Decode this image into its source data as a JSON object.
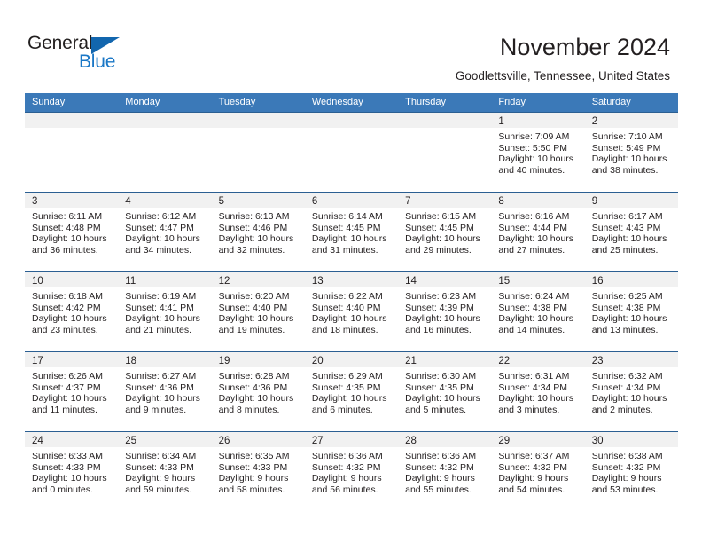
{
  "brand": {
    "word_one": "General",
    "word_two": "Blue",
    "triangle_color": "#1266ae",
    "blue_color": "#1a77c6"
  },
  "header": {
    "title": "November 2024",
    "location": "Goodlettsville, Tennessee, United States"
  },
  "theme": {
    "header_blue": "#3b79b8",
    "row_line": "#2b5f92",
    "daynum_band": "#f1f1f1",
    "text": "#231f20"
  },
  "weekdays": [
    "Sunday",
    "Monday",
    "Tuesday",
    "Wednesday",
    "Thursday",
    "Friday",
    "Saturday"
  ],
  "weeks": [
    [
      {
        "day": "",
        "sunrise": "",
        "sunset": "",
        "daylight_line1": "",
        "daylight_line2": ""
      },
      {
        "day": "",
        "sunrise": "",
        "sunset": "",
        "daylight_line1": "",
        "daylight_line2": ""
      },
      {
        "day": "",
        "sunrise": "",
        "sunset": "",
        "daylight_line1": "",
        "daylight_line2": ""
      },
      {
        "day": "",
        "sunrise": "",
        "sunset": "",
        "daylight_line1": "",
        "daylight_line2": ""
      },
      {
        "day": "",
        "sunrise": "",
        "sunset": "",
        "daylight_line1": "",
        "daylight_line2": ""
      },
      {
        "day": "1",
        "sunrise": "Sunrise: 7:09 AM",
        "sunset": "Sunset: 5:50 PM",
        "daylight_line1": "Daylight: 10 hours",
        "daylight_line2": "and 40 minutes."
      },
      {
        "day": "2",
        "sunrise": "Sunrise: 7:10 AM",
        "sunset": "Sunset: 5:49 PM",
        "daylight_line1": "Daylight: 10 hours",
        "daylight_line2": "and 38 minutes."
      }
    ],
    [
      {
        "day": "3",
        "sunrise": "Sunrise: 6:11 AM",
        "sunset": "Sunset: 4:48 PM",
        "daylight_line1": "Daylight: 10 hours",
        "daylight_line2": "and 36 minutes."
      },
      {
        "day": "4",
        "sunrise": "Sunrise: 6:12 AM",
        "sunset": "Sunset: 4:47 PM",
        "daylight_line1": "Daylight: 10 hours",
        "daylight_line2": "and 34 minutes."
      },
      {
        "day": "5",
        "sunrise": "Sunrise: 6:13 AM",
        "sunset": "Sunset: 4:46 PM",
        "daylight_line1": "Daylight: 10 hours",
        "daylight_line2": "and 32 minutes."
      },
      {
        "day": "6",
        "sunrise": "Sunrise: 6:14 AM",
        "sunset": "Sunset: 4:45 PM",
        "daylight_line1": "Daylight: 10 hours",
        "daylight_line2": "and 31 minutes."
      },
      {
        "day": "7",
        "sunrise": "Sunrise: 6:15 AM",
        "sunset": "Sunset: 4:45 PM",
        "daylight_line1": "Daylight: 10 hours",
        "daylight_line2": "and 29 minutes."
      },
      {
        "day": "8",
        "sunrise": "Sunrise: 6:16 AM",
        "sunset": "Sunset: 4:44 PM",
        "daylight_line1": "Daylight: 10 hours",
        "daylight_line2": "and 27 minutes."
      },
      {
        "day": "9",
        "sunrise": "Sunrise: 6:17 AM",
        "sunset": "Sunset: 4:43 PM",
        "daylight_line1": "Daylight: 10 hours",
        "daylight_line2": "and 25 minutes."
      }
    ],
    [
      {
        "day": "10",
        "sunrise": "Sunrise: 6:18 AM",
        "sunset": "Sunset: 4:42 PM",
        "daylight_line1": "Daylight: 10 hours",
        "daylight_line2": "and 23 minutes."
      },
      {
        "day": "11",
        "sunrise": "Sunrise: 6:19 AM",
        "sunset": "Sunset: 4:41 PM",
        "daylight_line1": "Daylight: 10 hours",
        "daylight_line2": "and 21 minutes."
      },
      {
        "day": "12",
        "sunrise": "Sunrise: 6:20 AM",
        "sunset": "Sunset: 4:40 PM",
        "daylight_line1": "Daylight: 10 hours",
        "daylight_line2": "and 19 minutes."
      },
      {
        "day": "13",
        "sunrise": "Sunrise: 6:22 AM",
        "sunset": "Sunset: 4:40 PM",
        "daylight_line1": "Daylight: 10 hours",
        "daylight_line2": "and 18 minutes."
      },
      {
        "day": "14",
        "sunrise": "Sunrise: 6:23 AM",
        "sunset": "Sunset: 4:39 PM",
        "daylight_line1": "Daylight: 10 hours",
        "daylight_line2": "and 16 minutes."
      },
      {
        "day": "15",
        "sunrise": "Sunrise: 6:24 AM",
        "sunset": "Sunset: 4:38 PM",
        "daylight_line1": "Daylight: 10 hours",
        "daylight_line2": "and 14 minutes."
      },
      {
        "day": "16",
        "sunrise": "Sunrise: 6:25 AM",
        "sunset": "Sunset: 4:38 PM",
        "daylight_line1": "Daylight: 10 hours",
        "daylight_line2": "and 13 minutes."
      }
    ],
    [
      {
        "day": "17",
        "sunrise": "Sunrise: 6:26 AM",
        "sunset": "Sunset: 4:37 PM",
        "daylight_line1": "Daylight: 10 hours",
        "daylight_line2": "and 11 minutes."
      },
      {
        "day": "18",
        "sunrise": "Sunrise: 6:27 AM",
        "sunset": "Sunset: 4:36 PM",
        "daylight_line1": "Daylight: 10 hours",
        "daylight_line2": "and 9 minutes."
      },
      {
        "day": "19",
        "sunrise": "Sunrise: 6:28 AM",
        "sunset": "Sunset: 4:36 PM",
        "daylight_line1": "Daylight: 10 hours",
        "daylight_line2": "and 8 minutes."
      },
      {
        "day": "20",
        "sunrise": "Sunrise: 6:29 AM",
        "sunset": "Sunset: 4:35 PM",
        "daylight_line1": "Daylight: 10 hours",
        "daylight_line2": "and 6 minutes."
      },
      {
        "day": "21",
        "sunrise": "Sunrise: 6:30 AM",
        "sunset": "Sunset: 4:35 PM",
        "daylight_line1": "Daylight: 10 hours",
        "daylight_line2": "and 5 minutes."
      },
      {
        "day": "22",
        "sunrise": "Sunrise: 6:31 AM",
        "sunset": "Sunset: 4:34 PM",
        "daylight_line1": "Daylight: 10 hours",
        "daylight_line2": "and 3 minutes."
      },
      {
        "day": "23",
        "sunrise": "Sunrise: 6:32 AM",
        "sunset": "Sunset: 4:34 PM",
        "daylight_line1": "Daylight: 10 hours",
        "daylight_line2": "and 2 minutes."
      }
    ],
    [
      {
        "day": "24",
        "sunrise": "Sunrise: 6:33 AM",
        "sunset": "Sunset: 4:33 PM",
        "daylight_line1": "Daylight: 10 hours",
        "daylight_line2": "and 0 minutes."
      },
      {
        "day": "25",
        "sunrise": "Sunrise: 6:34 AM",
        "sunset": "Sunset: 4:33 PM",
        "daylight_line1": "Daylight: 9 hours",
        "daylight_line2": "and 59 minutes."
      },
      {
        "day": "26",
        "sunrise": "Sunrise: 6:35 AM",
        "sunset": "Sunset: 4:33 PM",
        "daylight_line1": "Daylight: 9 hours",
        "daylight_line2": "and 58 minutes."
      },
      {
        "day": "27",
        "sunrise": "Sunrise: 6:36 AM",
        "sunset": "Sunset: 4:32 PM",
        "daylight_line1": "Daylight: 9 hours",
        "daylight_line2": "and 56 minutes."
      },
      {
        "day": "28",
        "sunrise": "Sunrise: 6:36 AM",
        "sunset": "Sunset: 4:32 PM",
        "daylight_line1": "Daylight: 9 hours",
        "daylight_line2": "and 55 minutes."
      },
      {
        "day": "29",
        "sunrise": "Sunrise: 6:37 AM",
        "sunset": "Sunset: 4:32 PM",
        "daylight_line1": "Daylight: 9 hours",
        "daylight_line2": "and 54 minutes."
      },
      {
        "day": "30",
        "sunrise": "Sunrise: 6:38 AM",
        "sunset": "Sunset: 4:32 PM",
        "daylight_line1": "Daylight: 9 hours",
        "daylight_line2": "and 53 minutes."
      }
    ]
  ]
}
